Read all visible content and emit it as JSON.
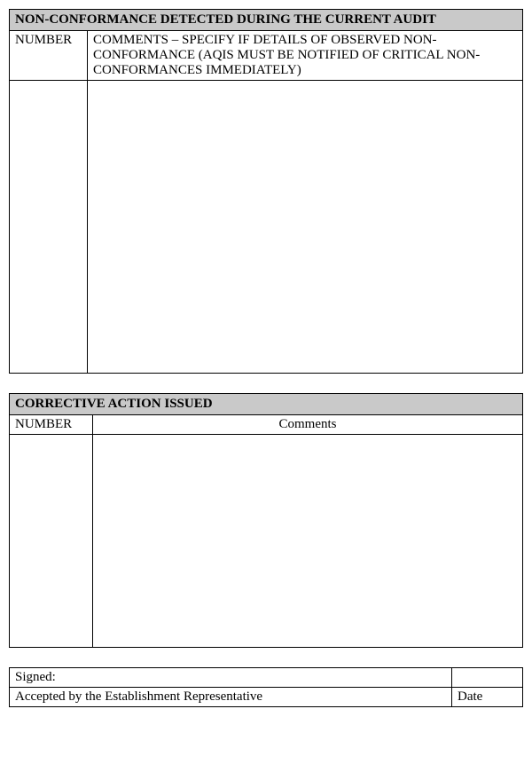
{
  "nonconformance": {
    "title": "NON-CONFORMANCE DETECTED DURING THE CURRENT AUDIT",
    "col_number": "NUMBER",
    "col_comments": "COMMENTS – SPECIFY IF DETAILS OF OBSERVED NON-CONFORMANCE (AQIS MUST BE NOTIFIED OF CRITICAL NON-CONFORMANCES IMMEDIATELY)",
    "number_value": "",
    "comments_value": ""
  },
  "corrective": {
    "title": "CORRECTIVE ACTION ISSUED",
    "col_number": "NUMBER",
    "col_comments": "Comments",
    "number_value": "",
    "comments_value": ""
  },
  "signature": {
    "signed_label": "Signed:",
    "signed_value": "",
    "accepted_label": "Accepted by the Establishment Representative",
    "date_label": "Date"
  }
}
